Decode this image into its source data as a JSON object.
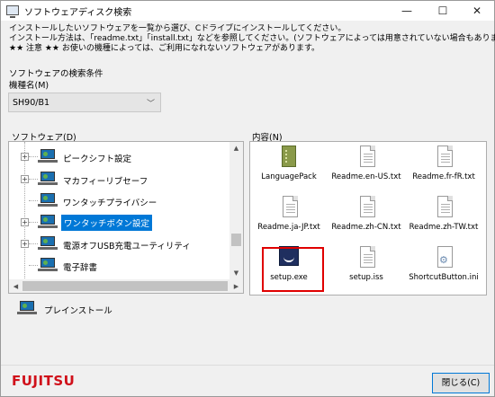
{
  "window": {
    "title": "ソフトウェアディスク検索"
  },
  "titlebar": {
    "minimize": "—",
    "maximize": "☐",
    "close": "✕"
  },
  "instructions": [
    "インストールしたいソフトウェアを一覧から選び、Cドライブにインストールしてください。",
    "インストール方法は、「readme.txt」「install.txt」などを参照してください。(ソフトウェアによっては用意されていない場合もあります)",
    "★★ 注意 ★★ お使いの機種によっては、ご利用になれないソフトウェアがあります。"
  ],
  "search": {
    "conditions_label": "ソフトウェアの検索条件",
    "model_label": "機種名(M)",
    "model_value": "SH90/B1"
  },
  "software": {
    "label": "ソフトウェア(D)",
    "items": [
      {
        "label": "ピークシフト設定",
        "expandable": true,
        "selected": false
      },
      {
        "label": "マカフィーリブセーフ",
        "expandable": true,
        "selected": false
      },
      {
        "label": "ワンタッチプライバシー",
        "expandable": false,
        "selected": false
      },
      {
        "label": "ワンタッチボタン設定",
        "expandable": true,
        "selected": true
      },
      {
        "label": "電源オフUSB充電ユーティリティ",
        "expandable": true,
        "selected": false
      },
      {
        "label": "電子辞書",
        "expandable": false,
        "selected": false
      }
    ]
  },
  "contents": {
    "label": "内容(N)",
    "files": [
      {
        "name": "LanguagePack",
        "icon": "folder-package-icon"
      },
      {
        "name": "Readme.en-US.txt",
        "icon": "text-document-icon"
      },
      {
        "name": "Readme.fr-fR.txt",
        "icon": "text-document-icon"
      },
      {
        "name": "Readme.ja-JP.txt",
        "icon": "text-document-icon"
      },
      {
        "name": "Readme.zh-CN.txt",
        "icon": "text-document-icon"
      },
      {
        "name": "Readme.zh-TW.txt",
        "icon": "text-document-icon"
      },
      {
        "name": "setup.exe",
        "icon": "setup-exe-icon"
      },
      {
        "name": "setup.iss",
        "icon": "text-document-icon"
      },
      {
        "name": "ShortcutButton.ini",
        "icon": "settings-file-icon"
      }
    ]
  },
  "preinstall_label": "プレインストール",
  "footer": {
    "logo": "FUJITSU",
    "close_label": "閉じる(C)"
  },
  "colors": {
    "selection": "#0078d7",
    "highlight_border": "#e00000",
    "logo": "#d0101a"
  }
}
